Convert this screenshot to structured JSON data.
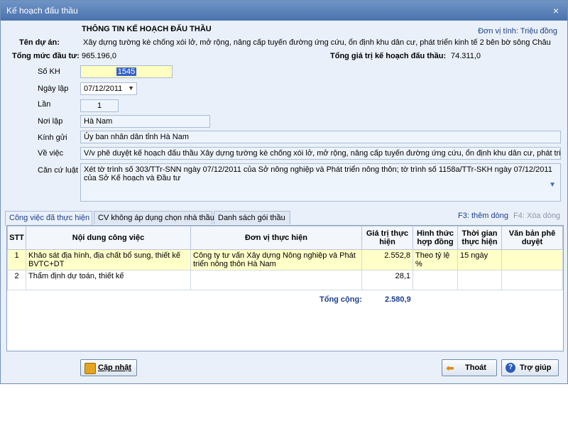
{
  "window": {
    "title": "Kế hoạch đấu thầu",
    "close": "×"
  },
  "header": {
    "title": "THÔNG TIN KẾ HOẠCH ĐẤU THẦU",
    "unit": "Đơn vị tính: Triệu đồng"
  },
  "project": {
    "name_label": "Tên dự án:",
    "name": "Xây dựng tường kè chống xói lở, mở rộng, nâng cấp tuyến đường ứng cứu, ổn định khu dân cư, phát triển kinh tế 2 bên bờ sông Châu",
    "total_invest_label": "Tổng mức đầu tư:",
    "total_invest": "965.196,0",
    "total_plan_label": "Tổng giá trị kế hoạch đấu thầu:",
    "total_plan": "74.311,0"
  },
  "form": {
    "so_kh_label": "Số KH",
    "so_kh": "1545",
    "ngay_lap_label": "Ngày lập",
    "ngay_lap": "07/12/2011",
    "lan_label": "Lần",
    "lan": "1",
    "noi_lap_label": "Nơi lập",
    "noi_lap": "Hà Nam",
    "kinh_gui_label": "Kính gửi",
    "kinh_gui": "Ủy ban nhân dân tỉnh Hà Nam",
    "ve_viec_label": "Về việc",
    "ve_viec": "V/v phê duyệt kế hoạch đấu thầu Xây dựng tường kè chống xói lở, mở rộng, nâng cấp tuyến đường ứng cứu, ổn định khu dân cư, phát triển ki",
    "can_cu_label": "Căn cứ luật",
    "can_cu_line1": "Xét tờ trình số 303/TTr-SNN ngày 07/12/2011 của Sở nông nghiệp và Phát triển nông thôn; tờ trình số 1158a/TTr-SKH ngày 07/12/2011",
    "can_cu_line2": "của Sở Kế hoạch và Đầu tư"
  },
  "tabs": [
    "Công việc đã thực hiện",
    "CV không áp dụng chọn nhà thầu",
    "Danh sách gói thầu"
  ],
  "shortcuts": {
    "add": "F3: thêm dòng",
    "delete": "F4: Xóa dòng"
  },
  "table": {
    "headers": [
      "STT",
      "Nội dung công việc",
      "Đơn vị thực hiện",
      "Giá trị thực hiện",
      "Hình thức hợp đồng",
      "Thời gian thực hiện",
      "Văn bản phê duyệt"
    ],
    "rows": [
      {
        "stt": "1",
        "noi_dung": "Khảo sát địa hình, địa chất bổ sung, thiết kế BVTC+DT",
        "don_vi": "Công ty tư vấn Xây dựng Nông nghiệp và Phát triển nông thôn Hà Nam",
        "gia_tri": "2.552,8",
        "hinh_thuc": "Theo tỷ lệ %",
        "thoi_gian": "15 ngày",
        "van_ban": ""
      },
      {
        "stt": "2",
        "noi_dung": "Thẩm định dự toán, thiết kế",
        "don_vi": "",
        "gia_tri": "28,1",
        "hinh_thuc": "",
        "thoi_gian": "",
        "van_ban": ""
      }
    ],
    "total_label": "Tổng cộng:",
    "total_value": "2.580,9"
  },
  "buttons": {
    "update": "Cập nhật",
    "exit": "Thoát",
    "help": "Trợ giúp"
  },
  "colors": {
    "titlebar": "#5580bb",
    "accent": "#1a3e8c",
    "selected_row": "#ffffc8"
  }
}
